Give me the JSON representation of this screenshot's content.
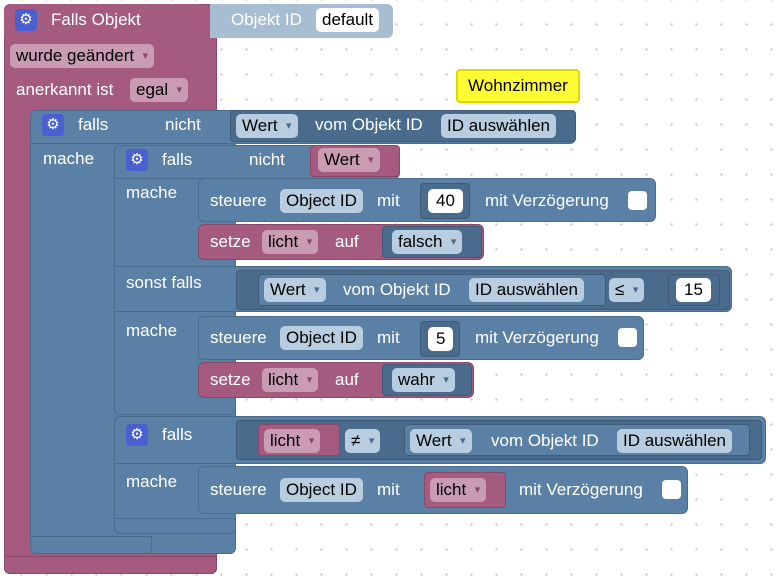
{
  "event_block": {
    "title": "Falls Objekt",
    "object_label": "Objekt ID",
    "object_value": "default",
    "changed_value": "wurde geändert",
    "ack_label": "anerkannt ist",
    "ack_value": "egal"
  },
  "comment": {
    "text": "Wohnzimmer"
  },
  "outer_if": {
    "if_label": "falls",
    "not_label": "nicht",
    "value_dropdown": "Wert",
    "from_object_label": "vom Objekt ID",
    "object_button": "ID auswählen",
    "do_label": "mache"
  },
  "inner_if": {
    "if_label": "falls",
    "not_label": "nicht",
    "var_dropdown": "Wert",
    "do_label": "mache",
    "control1": {
      "label": "steuere",
      "object": "Object ID",
      "with_label": "mit",
      "value": "40",
      "delay_label": "mit Verzögerung"
    },
    "set1": {
      "label": "setze",
      "var": "licht",
      "to_label": "auf",
      "value": "falsch"
    },
    "else_if_label": "sonst falls",
    "compare": {
      "value_dropdown": "Wert",
      "from_object_label": "vom Objekt ID",
      "object_button": "ID auswählen",
      "operator": "≤",
      "number": "15"
    },
    "do2_label": "mache",
    "control2": {
      "label": "steuere",
      "object": "Object ID",
      "with_label": "mit",
      "value": "5",
      "delay_label": "mit Verzögerung"
    },
    "set2": {
      "label": "setze",
      "var": "licht",
      "to_label": "auf",
      "value": "wahr"
    }
  },
  "third_if": {
    "if_label": "falls",
    "var_dropdown": "licht",
    "operator": "≠",
    "value_dropdown": "Wert",
    "from_object_label": "vom Objekt ID",
    "object_button": "ID auswählen",
    "do_label": "mache",
    "control": {
      "label": "steuere",
      "object": "Object ID",
      "with_label": "mit",
      "var": "licht",
      "delay_label": "mit Verzögerung"
    }
  }
}
